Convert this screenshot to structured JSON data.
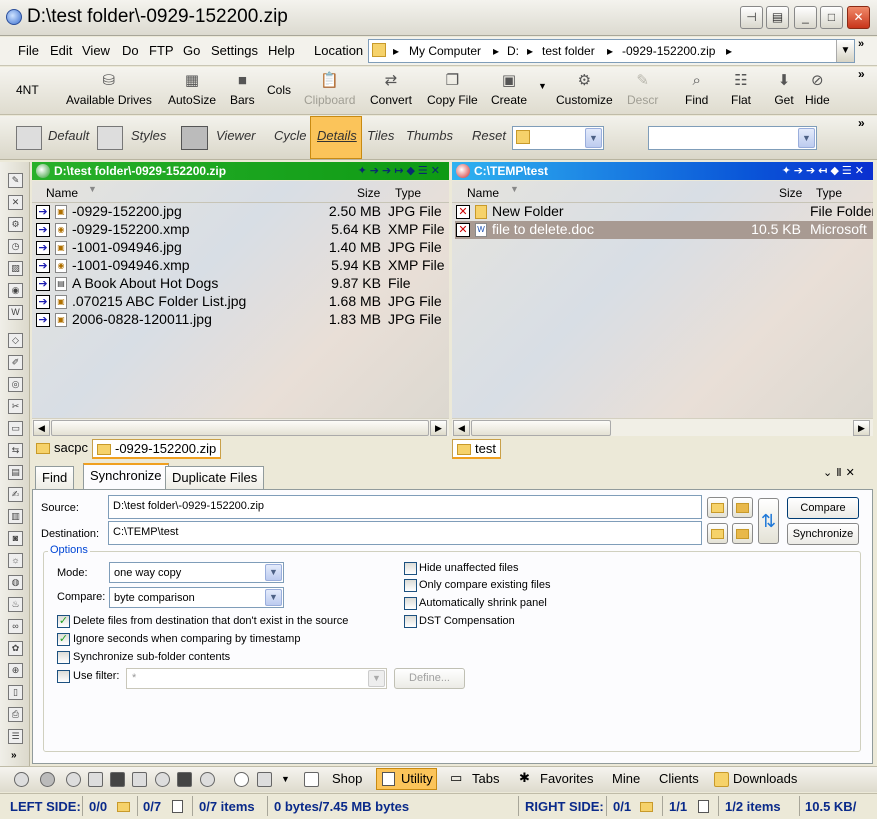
{
  "window": {
    "title": "D:\\test folder\\-0929-152200.zip"
  },
  "menu": {
    "items": [
      "File",
      "Edit",
      "View",
      "Do",
      "FTP",
      "Go",
      "Settings",
      "Help"
    ],
    "location_label": "Location"
  },
  "location": {
    "segments": [
      "My Computer",
      "D:",
      "test folder",
      "-0929-152200.zip"
    ]
  },
  "toolbar": {
    "fournt": "4NT",
    "available_drives": "Available Drives",
    "autosize": "AutoSize",
    "bars": "Bars",
    "cols": "Cols",
    "clipboard": "Clipboard",
    "convert": "Convert",
    "copy_file": "Copy File",
    "create": "Create",
    "customize": "Customize",
    "descr": "Descr",
    "find": "Find",
    "flat": "Flat",
    "get": "Get",
    "hide": "Hide"
  },
  "viewbar": {
    "default": "Default",
    "styles": "Styles",
    "viewer": "Viewer",
    "cycle": "Cycle",
    "details": "Details",
    "tiles": "Tiles",
    "thumbs": "Thumbs",
    "reset": "Reset"
  },
  "left_pane": {
    "path": "D:\\test folder\\-0929-152200.zip",
    "col_name": "Name",
    "col_size": "Size",
    "col_type": "Type",
    "files": [
      {
        "name": "-0929-152200.jpg",
        "size": "2.50 MB",
        "type": "JPG File"
      },
      {
        "name": "-0929-152200.xmp",
        "size": "5.64 KB",
        "type": "XMP File"
      },
      {
        "name": "-1001-094946.jpg",
        "size": "1.40 MB",
        "type": "JPG File"
      },
      {
        "name": "-1001-094946.xmp",
        "size": "5.94 KB",
        "type": "XMP File"
      },
      {
        "name": " A Book About Hot Dogs",
        "size": "9.87 KB",
        "type": "File"
      },
      {
        "name": ".070215 ABC Folder List.jpg",
        "size": "1.68 MB",
        "type": "JPG File"
      },
      {
        "name": "2006-0828-120011.jpg",
        "size": "1.83 MB",
        "type": "JPG File"
      }
    ],
    "tabs": [
      "sacpc",
      "-0929-152200.zip"
    ]
  },
  "right_pane": {
    "path": "C:\\TEMP\\test",
    "col_name": "Name",
    "col_size": "Size",
    "col_type": "Type",
    "files": [
      {
        "name": "New Folder",
        "size": "",
        "type": "File Folder"
      },
      {
        "name": "file to delete.doc",
        "size": "10.5 KB",
        "type": "Microsoft"
      }
    ],
    "tabs": [
      "test"
    ]
  },
  "bottom_panel": {
    "tabs": [
      "Find",
      "Synchronize",
      "Duplicate Files"
    ],
    "source_label": "Source:",
    "source_value": "D:\\test folder\\-0929-152200.zip",
    "destination_label": "Destination:",
    "destination_value": "C:\\TEMP\\test",
    "compare_button": "Compare",
    "synchronize_button": "Synchronize",
    "options_title": "Options",
    "mode_label": "Mode:",
    "mode_value": "one way copy",
    "compare_label": "Compare:",
    "compare_value": "byte comparison",
    "check_delete": "Delete files from destination that don't exist in the source",
    "check_ignore": "Ignore seconds when comparing by timestamp",
    "check_subfolder": "Synchronize sub-folder contents",
    "check_filter": "Use filter:",
    "filter_value": "*",
    "define_button": "Define...",
    "check_hide": "Hide unaffected files",
    "check_only": "Only compare existing files",
    "check_shrink": "Automatically shrink panel",
    "check_dst": "DST Compensation"
  },
  "bottombar": {
    "shop": "Shop",
    "utility": "Utility",
    "tabs": "Tabs",
    "favorites": "Favorites",
    "mine": "Mine",
    "clients": "Clients",
    "downloads": "Downloads"
  },
  "status": {
    "left_side": "LEFT SIDE:",
    "l_folders": "0/0",
    "l_files": "0/7",
    "l_items": "0/7 items",
    "l_bytes": "0 bytes/7.45 MB bytes",
    "right_side": "RIGHT SIDE:",
    "r_folders": "0/1",
    "r_files": "1/1",
    "r_items": "1/2  items",
    "r_size": "10.5 KB/"
  }
}
